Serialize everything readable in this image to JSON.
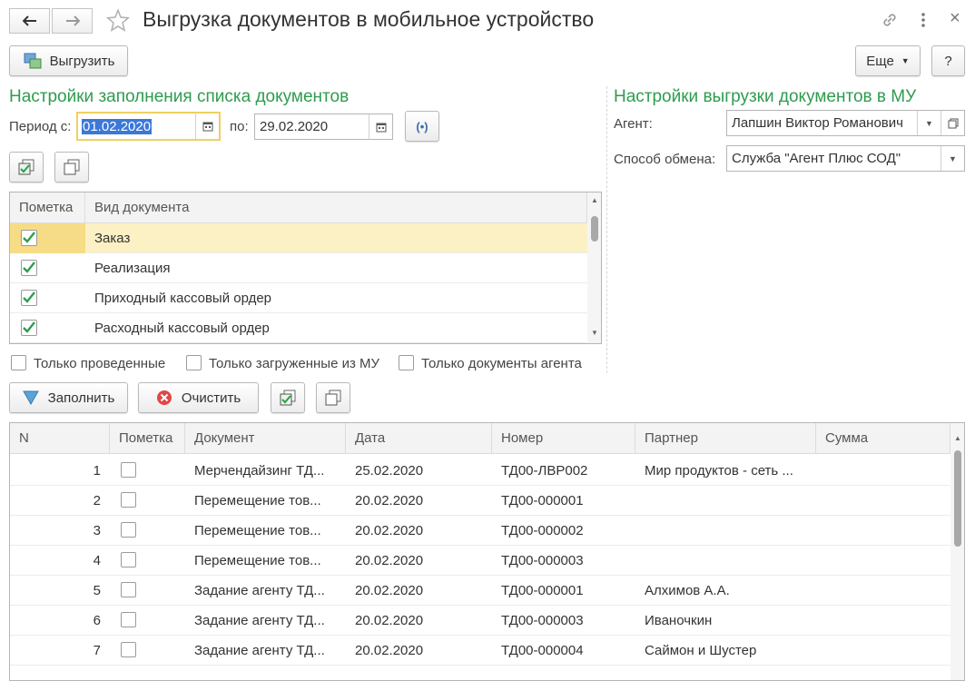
{
  "window": {
    "title": "Выгрузка документов в мобильное устройство",
    "back_icon": "arrow-left-icon",
    "forward_icon": "arrow-right-icon",
    "star_icon": "star-icon",
    "link_icon": "link-icon",
    "more_icon": "vertical-dots-icon",
    "close_label": "×"
  },
  "toolbar": {
    "upload_label": "Выгрузить",
    "more_label": "Еще",
    "help_label": "?"
  },
  "left_settings": {
    "title": "Настройки заполнения списка документов",
    "period_from_label": "Период с:",
    "period_from_value": "01.02.2020",
    "period_to_label": "по:",
    "period_to_value": "29.02.2020"
  },
  "doc_types": {
    "headers": [
      "Пометка",
      "Вид документа"
    ],
    "rows": [
      {
        "checked": true,
        "name": "Заказ"
      },
      {
        "checked": true,
        "name": "Реализация"
      },
      {
        "checked": true,
        "name": "Приходный кассовый ордер"
      },
      {
        "checked": true,
        "name": "Расходный кассовый ордер"
      }
    ]
  },
  "filters": {
    "only_posted": "Только проведенные",
    "only_loaded": "Только загруженные из МУ",
    "only_agent": "Только документы агента"
  },
  "actions": {
    "fill_label": "Заполнить",
    "clear_label": "Очистить"
  },
  "right_settings": {
    "title": "Настройки выгрузки документов в МУ",
    "agent_label": "Агент:",
    "agent_value": "Лапшин Виктор Романович",
    "exchange_label": "Способ обмена:",
    "exchange_value": "Служба \"Агент Плюс СОД\""
  },
  "docs_table": {
    "headers": [
      "N",
      "Пометка",
      "Документ",
      "Дата",
      "Номер",
      "Партнер",
      "Сумма"
    ],
    "rows": [
      {
        "n": "1",
        "doc": "Мерчендайзинг ТД...",
        "date": "25.02.2020",
        "number": "ТД00-ЛВР002",
        "partner": "Мир продуктов - сеть ..."
      },
      {
        "n": "2",
        "doc": "Перемещение тов...",
        "date": "20.02.2020",
        "number": "ТД00-000001",
        "partner": ""
      },
      {
        "n": "3",
        "doc": "Перемещение тов...",
        "date": "20.02.2020",
        "number": "ТД00-000002",
        "partner": ""
      },
      {
        "n": "4",
        "doc": "Перемещение тов...",
        "date": "20.02.2020",
        "number": "ТД00-000003",
        "partner": ""
      },
      {
        "n": "5",
        "doc": "Задание агенту ТД...",
        "date": "20.02.2020",
        "number": "ТД00-000001",
        "partner": "Алхимов А.А."
      },
      {
        "n": "6",
        "doc": "Задание агенту ТД...",
        "date": "20.02.2020",
        "number": "ТД00-000003",
        "partner": "Иваночкин"
      },
      {
        "n": "7",
        "doc": "Задание агенту ТД...",
        "date": "20.02.2020",
        "number": "ТД00-000004",
        "partner": "Саймон и Шустер"
      }
    ]
  },
  "colors": {
    "accent_green": "#2e9c4e",
    "selected_row": "#fbf1c4",
    "focus_border": "#f0d060"
  }
}
